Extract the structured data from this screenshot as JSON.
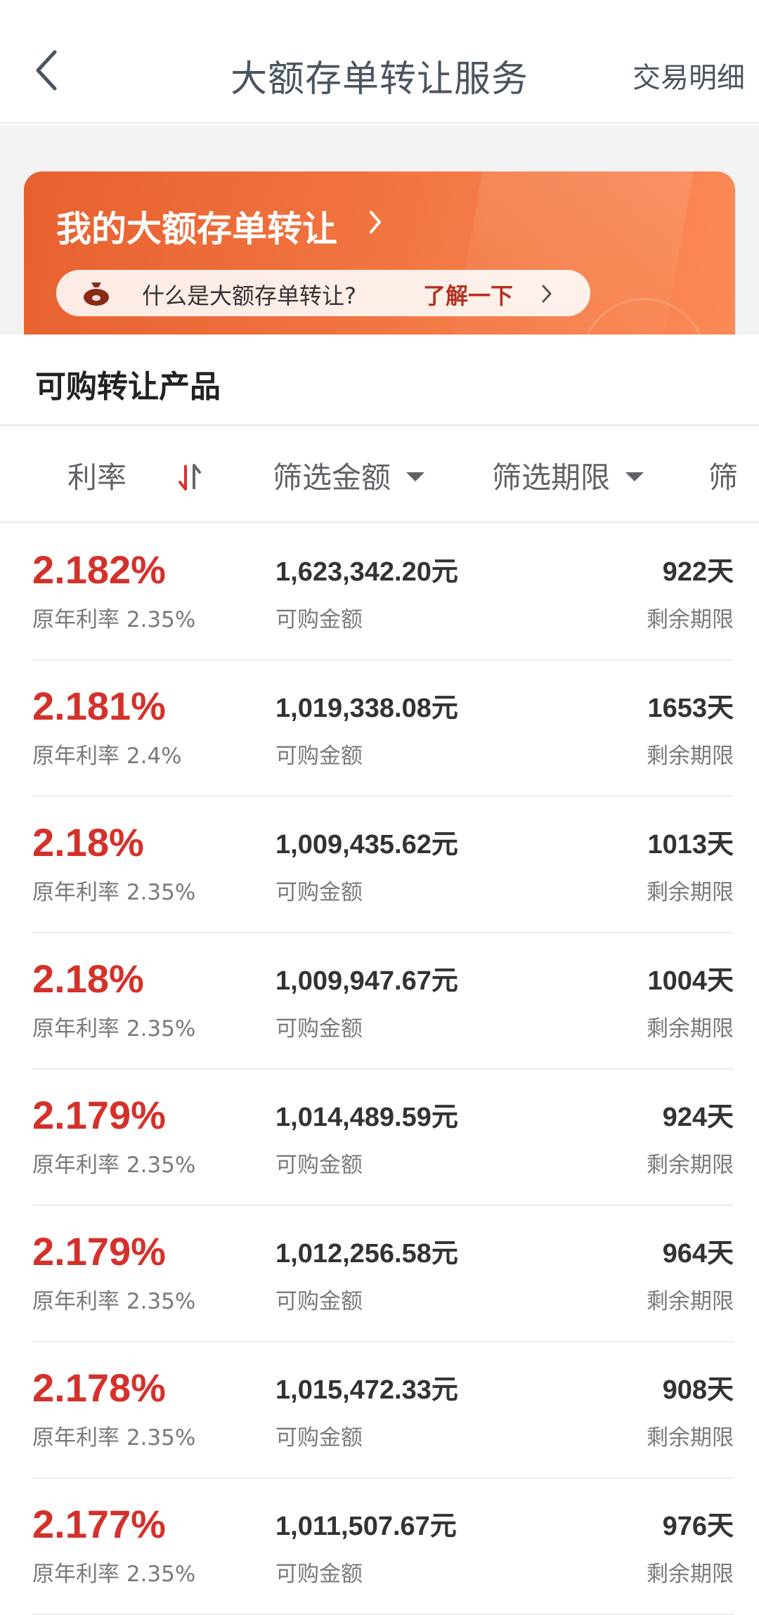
{
  "header": {
    "title": "大额存单转让服务",
    "right_link": "交易明细"
  },
  "banner": {
    "title": "我的大额存单转让",
    "question": "什么是大额存单转让?",
    "link": "了解一下"
  },
  "section": {
    "title": "可购转让产品"
  },
  "filters": {
    "rate": "利率",
    "amount": "筛选金额",
    "term": "筛选期限",
    "cut": "筛"
  },
  "colors": {
    "accent_red": "#d4312a",
    "banner_orange": "#f0733f"
  },
  "products": [
    {
      "rate": "2.182%",
      "orig": "原年利率 2.35%",
      "amount": "1,623,342.20元",
      "amount_label": "可购金额",
      "days": "922天",
      "days_label": "剩余期限"
    },
    {
      "rate": "2.181%",
      "orig": "原年利率 2.4%",
      "amount": "1,019,338.08元",
      "amount_label": "可购金额",
      "days": "1653天",
      "days_label": "剩余期限"
    },
    {
      "rate": "2.18%",
      "orig": "原年利率 2.35%",
      "amount": "1,009,435.62元",
      "amount_label": "可购金额",
      "days": "1013天",
      "days_label": "剩余期限"
    },
    {
      "rate": "2.18%",
      "orig": "原年利率 2.35%",
      "amount": "1,009,947.67元",
      "amount_label": "可购金额",
      "days": "1004天",
      "days_label": "剩余期限"
    },
    {
      "rate": "2.179%",
      "orig": "原年利率 2.35%",
      "amount": "1,014,489.59元",
      "amount_label": "可购金额",
      "days": "924天",
      "days_label": "剩余期限"
    },
    {
      "rate": "2.179%",
      "orig": "原年利率 2.35%",
      "amount": "1,012,256.58元",
      "amount_label": "可购金额",
      "days": "964天",
      "days_label": "剩余期限"
    },
    {
      "rate": "2.178%",
      "orig": "原年利率 2.35%",
      "amount": "1,015,472.33元",
      "amount_label": "可购金额",
      "days": "908天",
      "days_label": "剩余期限"
    },
    {
      "rate": "2.177%",
      "orig": "原年利率 2.35%",
      "amount": "1,011,507.67元",
      "amount_label": "可购金额",
      "days": "976天",
      "days_label": "剩余期限"
    }
  ]
}
